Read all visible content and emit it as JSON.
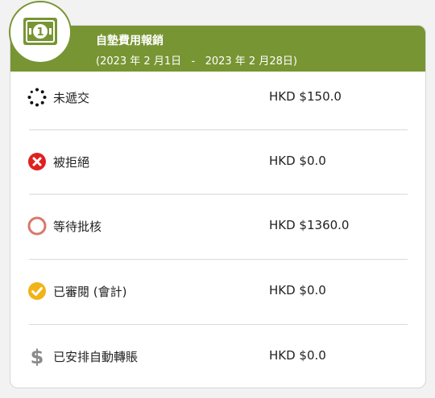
{
  "header": {
    "title": "自墊費用報銷",
    "date_range": "(2023 年 2 月1日   -   2023 年 2 月28日)",
    "badge_icon": "banknote-icon",
    "color": "#789533"
  },
  "items": [
    {
      "label": "未遞交",
      "amount": "HKD $150.0",
      "icon": "loading-dots-icon",
      "color": "#111111"
    },
    {
      "label": "被拒絕",
      "amount": "HKD $0.0",
      "icon": "x-circle-icon",
      "color": "#e02020"
    },
    {
      "label": "等待批核",
      "amount": "HKD $1360.0",
      "icon": "ring-icon",
      "color": "#d9786a"
    },
    {
      "label": "已審閱 (會計)",
      "amount": "HKD $0.0",
      "icon": "check-circle-icon",
      "color": "#f2b318"
    },
    {
      "label": "已安排自動轉賬",
      "amount": "HKD $0.0",
      "icon": "dollar-icon",
      "color": "#8a8a8a"
    }
  ]
}
